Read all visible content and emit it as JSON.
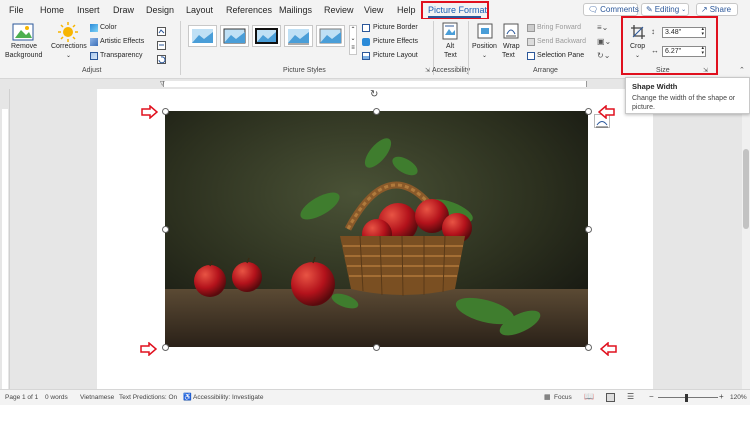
{
  "menu": {
    "tabs": [
      "File",
      "Home",
      "Insert",
      "Draw",
      "Design",
      "Layout",
      "References",
      "Mailings",
      "Review",
      "View",
      "Help"
    ],
    "active_tab": "Picture Format",
    "comments_label": "Comments",
    "editing_label": "Editing",
    "share_label": "Share"
  },
  "ribbon": {
    "adjust": {
      "remove_background_line1": "Remove",
      "remove_background_line2": "Background",
      "corrections": "Corrections",
      "color": "Color",
      "artistic_effects": "Artistic Effects",
      "transparency": "Transparency",
      "group_label": "Adjust"
    },
    "picture_styles": {
      "group_label": "Picture Styles",
      "picture_border": "Picture Border",
      "picture_effects": "Picture Effects",
      "picture_layout": "Picture Layout"
    },
    "accessibility": {
      "alt_text_line1": "Alt",
      "alt_text_line2": "Text",
      "group_label": "Accessibility"
    },
    "arrange": {
      "position": "Position",
      "wrap_text_line1": "Wrap",
      "wrap_text_line2": "Text",
      "bring_forward": "Bring Forward",
      "send_backward": "Send Backward",
      "selection_pane": "Selection Pane",
      "group_label": "Arrange"
    },
    "size": {
      "crop": "Crop",
      "height_value": "3.48\"",
      "width_value": "6.27\"",
      "group_label": "Size"
    }
  },
  "tooltip": {
    "title": "Shape Width",
    "body": "Change the width of the shape or picture."
  },
  "status": {
    "page": "Page 1 of 1",
    "words": "0 words",
    "language": "Vietnamese",
    "text_predictions": "Text Predictions: On",
    "accessibility": "Accessibility: Investigate",
    "focus": "Focus",
    "zoom": "120%"
  },
  "colors": {
    "accent": "#2b579a",
    "highlight_red": "#e0101e",
    "ribbon_bg": "#f3f3f3",
    "canvas_bg": "#e6e6e6"
  }
}
